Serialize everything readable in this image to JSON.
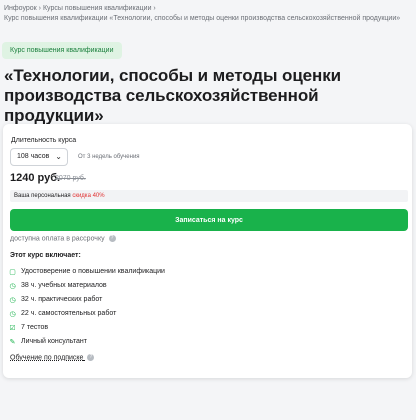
{
  "breadcrumb": {
    "line1": "Инфоурок › Курсы повышения квалификации ›",
    "line2": "Курс повышения квалификации «Технологии, способы и методы оценки производства сельскохозяйственной продукции»"
  },
  "tag": "Курс повышения квалификации",
  "title": "«Технологии, способы и методы оценки производства сельскохозяйственной продукции»",
  "card": {
    "duration_label": "Длительность курса",
    "duration_select": "108 часов",
    "duration_note": "От 3 недель обучения",
    "price": "1240 руб.",
    "old_price": "2070 руб.",
    "discount_prefix": "Ваша персональная ",
    "discount_value": "скидка 40%",
    "cta": "Записаться на курс",
    "installment": "доступна оплата в рассрочку",
    "includes_heading": "Этот курс включает:",
    "includes": [
      "Удостоверение о повышении квалификации",
      "38 ч. учебных материалов",
      "32 ч. практических работ",
      "22 ч. самостоятельных работ",
      "7 тестов",
      "Личный консультант"
    ],
    "subscription": "Обучение по подписке"
  },
  "colors": {
    "accent_green": "#19b24b",
    "tag_bg": "#dff3e3",
    "discount_red": "#e03131"
  },
  "icons": [
    "certificate-icon",
    "clock-icon",
    "clock-icon",
    "clock-icon",
    "checklist-icon",
    "consultant-icon"
  ]
}
